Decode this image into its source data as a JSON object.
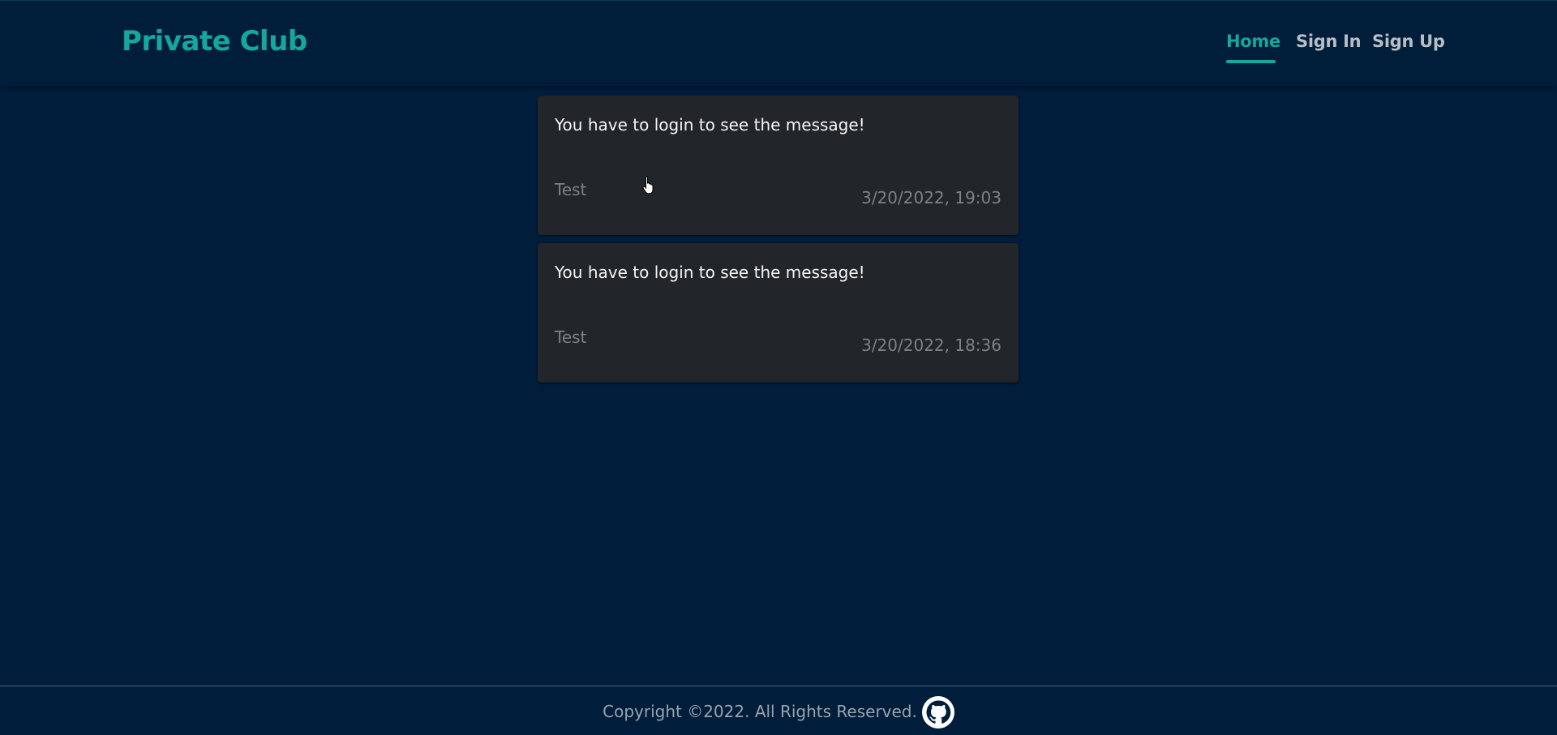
{
  "header": {
    "brand": "Private Club",
    "nav": [
      {
        "label": "Home",
        "active": true
      },
      {
        "label": "Sign In",
        "active": false
      },
      {
        "label": "Sign Up",
        "active": false
      }
    ]
  },
  "messages": [
    {
      "text": "You have to login to see the message!",
      "author": "Test",
      "timestamp": "3/20/2022, 19:03"
    },
    {
      "text": "You have to login to see the message!",
      "author": "Test",
      "timestamp": "3/20/2022, 18:36"
    }
  ],
  "footer": {
    "copyright": "Copyright ©2022. All Rights Reserved.",
    "icon": "github-icon"
  },
  "colors": {
    "background": "#001e3c",
    "accent": "#14a7a0",
    "card": "#222529",
    "muted_text": "#7d8286"
  }
}
